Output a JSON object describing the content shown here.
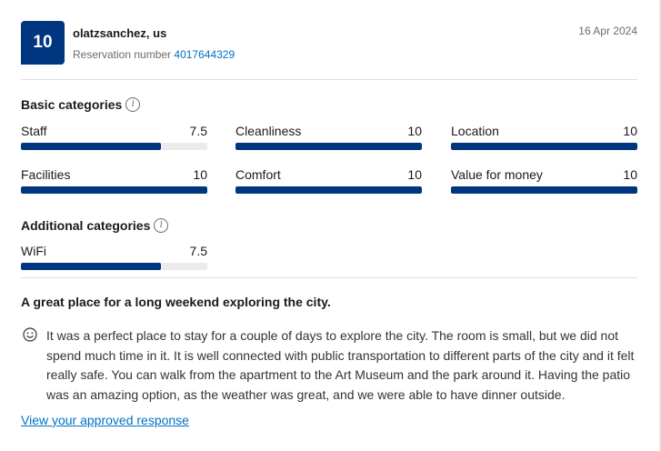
{
  "header": {
    "score": "10",
    "guest": "olatzsanchez, us",
    "reservation_label": "Reservation number",
    "reservation_number": "4017644329",
    "date": "16 Apr 2024"
  },
  "basic": {
    "title": "Basic categories",
    "items": [
      {
        "label": "Staff",
        "value": "7.5",
        "score": 7.5
      },
      {
        "label": "Cleanliness",
        "value": "10",
        "score": 10
      },
      {
        "label": "Location",
        "value": "10",
        "score": 10
      },
      {
        "label": "Facilities",
        "value": "10",
        "score": 10
      },
      {
        "label": "Comfort",
        "value": "10",
        "score": 10
      },
      {
        "label": "Value for money",
        "value": "10",
        "score": 10
      }
    ]
  },
  "additional": {
    "title": "Additional categories",
    "items": [
      {
        "label": "WiFi",
        "value": "7.5",
        "score": 7.5
      }
    ]
  },
  "review": {
    "title": "A great place for a long weekend exploring the city.",
    "text": "It was a perfect place to stay for a couple of days to explore the city. The room is small, but we did not spend much time in it. It is well connected with public transportation to different parts of the city and it felt really safe. You can walk from the apartment to the Art Museum and the park around it. Having the patio was an amazing option, as the weather was great, and we were able to have dinner outside.",
    "link": "View your approved response"
  },
  "colors": {
    "brand": "#003580",
    "link": "#0071c2",
    "track": "#ebebeb"
  }
}
